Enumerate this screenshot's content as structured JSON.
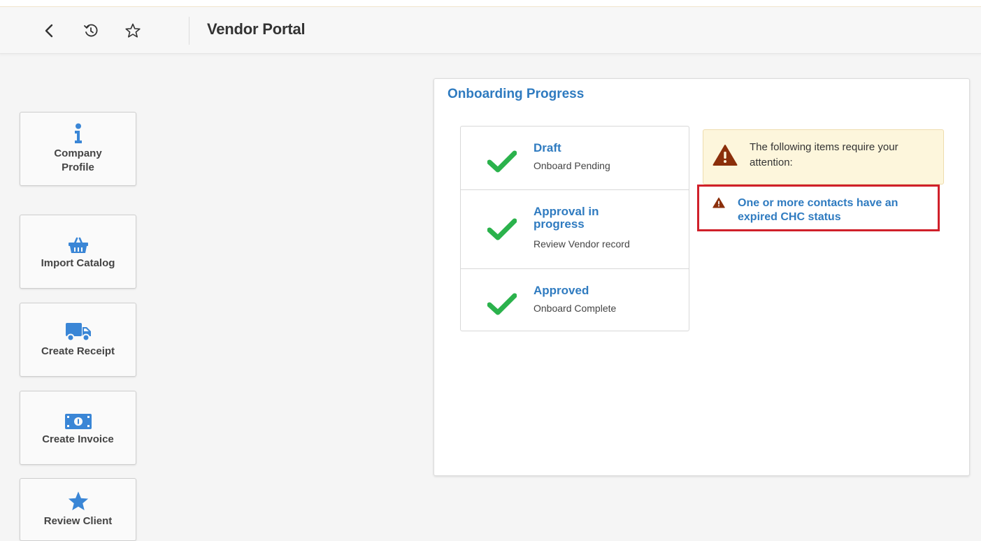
{
  "header": {
    "title": "Vendor Portal",
    "icons": [
      "back-chevron-icon",
      "history-icon",
      "star-outline-icon"
    ]
  },
  "sidebar": {
    "tiles": [
      {
        "label_line1": "Company",
        "label_line2": "Profile",
        "icon": "info-icon"
      },
      {
        "label": "Import Catalog",
        "icon": "basket-icon"
      },
      {
        "label": "Create Receipt",
        "icon": "truck-icon"
      },
      {
        "label": "Create Invoice",
        "icon": "money-bill-icon"
      },
      {
        "label": "Review Client",
        "icon": "star-icon"
      }
    ]
  },
  "onboarding": {
    "title": "Onboarding Progress",
    "steps": [
      {
        "title": "Draft",
        "subtitle": "Onboard Pending",
        "status_icon": "check-icon"
      },
      {
        "title": "Approval in progress",
        "subtitle": "Review Vendor record",
        "status_icon": "check-icon"
      },
      {
        "title": "Approved",
        "subtitle": "Onboard Complete",
        "status_icon": "check-icon"
      }
    ],
    "alert": {
      "text": "The following items require your attention:",
      "icon": "warning-icon"
    },
    "issues": [
      {
        "text": "One or more contacts have an expired CHC status",
        "icon": "warning-icon"
      }
    ]
  },
  "colors": {
    "link_blue": "#2f7bc0",
    "icon_blue": "#3a86d6",
    "check_green": "#2bb24c",
    "warning_brown": "#8b2f0b",
    "alert_bg": "#fdf6dc",
    "highlight_red": "#d0202a"
  }
}
